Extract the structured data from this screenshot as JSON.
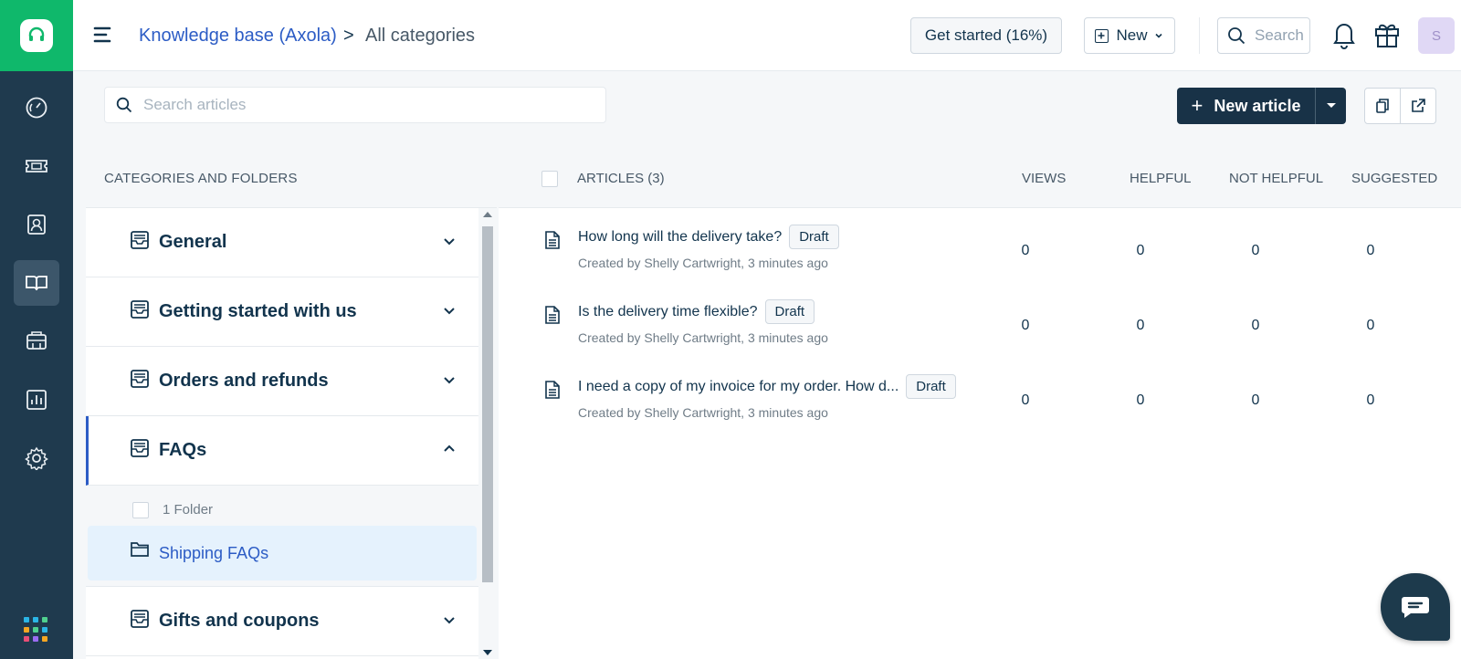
{
  "app": {
    "brand_color": "#0fb86b",
    "nav_bg": "#1f3a4e"
  },
  "nav": {
    "items": [
      {
        "name": "dashboard-icon"
      },
      {
        "name": "tickets-icon"
      },
      {
        "name": "contacts-icon"
      },
      {
        "name": "knowledge-base-icon",
        "active": true
      },
      {
        "name": "admin-icon"
      },
      {
        "name": "reports-icon"
      },
      {
        "name": "settings-icon"
      }
    ]
  },
  "header": {
    "breadcrumb_link": "Knowledge base (Axola)",
    "breadcrumb_sep": ">",
    "breadcrumb_current": "All categories",
    "get_started": "Get started (16%)",
    "new_label": "New",
    "search_placeholder": "Search",
    "avatar_initial": "S"
  },
  "toolbar": {
    "search_placeholder": "Search articles",
    "new_article": "New article"
  },
  "categories": {
    "header": "CATEGORIES AND FOLDERS",
    "items": [
      {
        "name": "General"
      },
      {
        "name": "Getting started with us"
      },
      {
        "name": "Orders and refunds"
      },
      {
        "name": "FAQs",
        "expanded": true
      },
      {
        "name": "Gifts and coupons"
      }
    ],
    "folder_count": "1 Folder",
    "folder_name": "Shipping FAQs"
  },
  "articles": {
    "header": "ARTICLES (3)",
    "columns": [
      "VIEWS",
      "HELPFUL",
      "NOT HELPFUL",
      "SUGGESTED"
    ],
    "rows": [
      {
        "title": "How long will the delivery take?",
        "status": "Draft",
        "meta": "Created by Shelly Cartwright, 3 minutes ago",
        "views": "0",
        "helpful": "0",
        "not_helpful": "0",
        "suggested": "0"
      },
      {
        "title": "Is the delivery time flexible?",
        "status": "Draft",
        "meta": "Created by Shelly Cartwright, 3 minutes ago",
        "views": "0",
        "helpful": "0",
        "not_helpful": "0",
        "suggested": "0"
      },
      {
        "title": "I need a copy of my invoice for my order. How d...",
        "status": "Draft",
        "meta": "Created by Shelly Cartwright, 3 minutes ago",
        "views": "0",
        "helpful": "0",
        "not_helpful": "0",
        "suggested": "0"
      }
    ]
  }
}
